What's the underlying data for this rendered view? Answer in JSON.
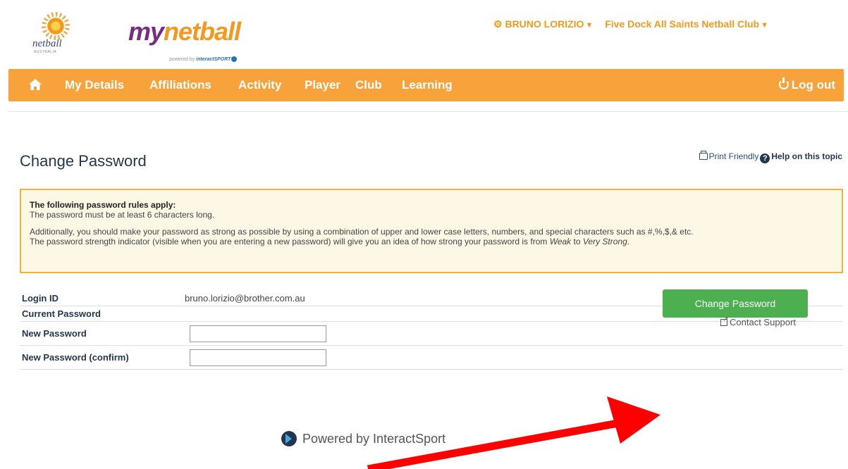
{
  "header": {
    "netball_logo_text": "netball",
    "netball_logo_sub": "AUSTRALIA",
    "mynetball_my": "my",
    "mynetball_net": "netball",
    "powered_small": "powered by",
    "powered_small_brand": "interactSPORT",
    "user_name": "BRUNO LORIZIO",
    "club_name": "Five Dock All Saints Netball Club",
    "user_icon": "gear-icon",
    "colors": {
      "brand_orange": "#f39a1e",
      "brand_purple": "#7a2d80"
    }
  },
  "nav": {
    "home_icon": "home-icon",
    "items": [
      "My Details",
      "Affiliations",
      "Activity",
      "Player",
      "Club",
      "Learning"
    ],
    "logout_label": "Log out",
    "bar_color": "#f7a23a"
  },
  "page": {
    "title": "Change Password",
    "print_label": "Print Friendly",
    "help_label": "Help on this topic"
  },
  "rules": {
    "heading": "The following password rules apply:",
    "line1": "The password must be at least 6 characters long.",
    "line2": "Additionally, you should make your password as strong as possible by using a combination of upper and lower case letters, numbers, and special characters such as #,%,$,& etc.",
    "line3_pre": "The password strength indicator (visible when you are entering a new password) will give you an idea of how strong your password is from ",
    "line3_weak": "Weak",
    "line3_mid": " to ",
    "line3_strong": "Very Strong",
    "line3_end": "."
  },
  "form": {
    "login_label": "Login ID",
    "login_value": "bruno.lorizio@brother.com.au",
    "current_label": "Current Password",
    "new_label": "New Password",
    "new_value": "",
    "confirm_label": "New Password (confirm)",
    "confirm_value": "",
    "submit_label": "Change Password",
    "submit_color": "#4caf50"
  },
  "footer": {
    "powered_by": "Powered by InteractSport",
    "contact_label": "Contact Support"
  },
  "annotation": {
    "arrow_color": "#ff0000"
  }
}
